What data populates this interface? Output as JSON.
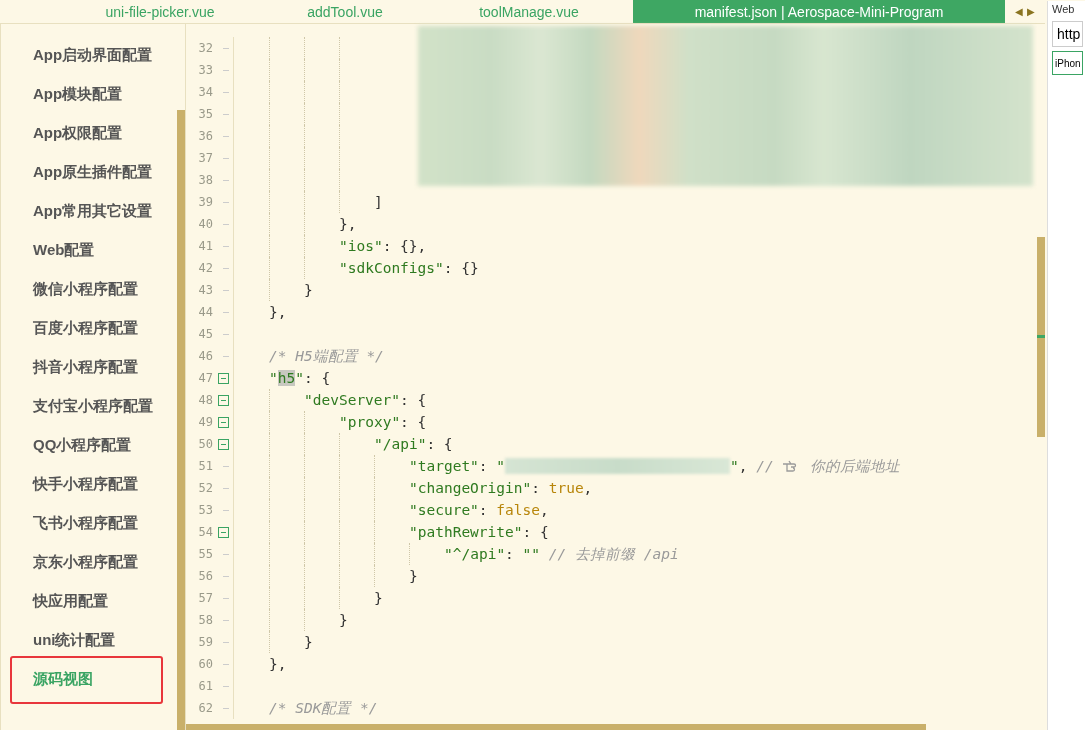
{
  "tabs": [
    {
      "label": "uni-file-picker.vue",
      "selected": false
    },
    {
      "label": "addTool.vue",
      "selected": false
    },
    {
      "label": "toolManage.vue",
      "selected": false
    },
    {
      "label": "manifest.json | Aerospace-Mini-Program",
      "selected": true
    }
  ],
  "tab_arrows": [
    "◀",
    "▶"
  ],
  "sidebar": {
    "items": [
      {
        "label": "App启动界面配置",
        "selected": false,
        "outlined": false
      },
      {
        "label": "App模块配置",
        "selected": false,
        "outlined": false
      },
      {
        "label": "App权限配置",
        "selected": false,
        "outlined": false
      },
      {
        "label": "App原生插件配置",
        "selected": false,
        "outlined": false
      },
      {
        "label": "App常用其它设置",
        "selected": false,
        "outlined": false
      },
      {
        "label": "Web配置",
        "selected": false,
        "outlined": false
      },
      {
        "label": "微信小程序配置",
        "selected": false,
        "outlined": false
      },
      {
        "label": "百度小程序配置",
        "selected": false,
        "outlined": false
      },
      {
        "label": "抖音小程序配置",
        "selected": false,
        "outlined": false
      },
      {
        "label": "支付宝小程序配置",
        "selected": false,
        "outlined": false
      },
      {
        "label": "QQ小程序配置",
        "selected": false,
        "outlined": false
      },
      {
        "label": "快手小程序配置",
        "selected": false,
        "outlined": false
      },
      {
        "label": "飞书小程序配置",
        "selected": false,
        "outlined": false
      },
      {
        "label": "京东小程序配置",
        "selected": false,
        "outlined": false
      },
      {
        "label": "快应用配置",
        "selected": false,
        "outlined": false
      },
      {
        "label": "uni统计配置",
        "selected": false,
        "outlined": false
      },
      {
        "label": "源码视图",
        "selected": true,
        "outlined": true
      }
    ]
  },
  "editor": {
    "lines": [
      {
        "children": [
          {
            "children": [
              {
                "children": [
                  {
                    "number": "32",
                    "fold": false,
                    "tokens": [
                      {
                        "kind": "blurred_block"
                      }
                    ]
                  },
                  {
                    "number": "33",
                    "fold": false
                  },
                  {
                    "number": "34",
                    "fold": false
                  },
                  {
                    "number": "35",
                    "fold": false
                  },
                  {
                    "number": "36",
                    "fold": false
                  },
                  {
                    "number": "37",
                    "fold": false
                  },
                  {
                    "number": "38",
                    "fold": false
                  },
                  {
                    "number": "39",
                    "fold": false,
                    "tokens": [
                      {
                        "kind": "punct",
                        "text": "]"
                      }
                    ]
                  }
                ]
              },
              {
                "number": "40",
                "fold": false,
                "tokens": [
                  {
                    "kind": "punct",
                    "text": "},"
                  }
                ]
              },
              {
                "number": "41",
                "fold": false,
                "tokens": [
                  {
                    "kind": "key",
                    "text": "\"ios\""
                  },
                  {
                    "kind": "punct",
                    "text": ": {},"
                  }
                ]
              },
              {
                "number": "42",
                "fold": false,
                "tokens": [
                  {
                    "kind": "key",
                    "text": "\"sdkConfigs\""
                  },
                  {
                    "kind": "punct",
                    "text": ": {}"
                  }
                ]
              }
            ]
          },
          {
            "number": "43",
            "fold": false,
            "tokens": [
              {
                "kind": "punct",
                "text": "}"
              }
            ]
          }
        ]
      },
      {
        "number": "44",
        "fold": false,
        "tokens": [
          {
            "kind": "punct",
            "text": "},"
          }
        ]
      },
      {
        "number": "45",
        "fold": false
      },
      {
        "number": "46",
        "fold": false,
        "tokens": [
          {
            "kind": "comment",
            "text": "/* H5端配置 */"
          }
        ]
      },
      {
        "number": "47",
        "fold": true,
        "tokens": [
          {
            "kind": "key",
            "text": "\""
          },
          {
            "kind": "match",
            "text": "h5"
          },
          {
            "kind": "key",
            "text": "\""
          },
          {
            "kind": "punct",
            "text": ": {"
          }
        ],
        "children": [
          {
            "number": "48",
            "fold": true,
            "tokens": [
              {
                "kind": "key",
                "text": "\"devServer\""
              },
              {
                "kind": "punct",
                "text": ": {"
              }
            ],
            "children": [
              {
                "number": "49",
                "fold": true,
                "tokens": [
                  {
                    "kind": "key",
                    "text": "\"proxy\""
                  },
                  {
                    "kind": "punct",
                    "text": ": {"
                  }
                ],
                "children": [
                  {
                    "number": "50",
                    "fold": true,
                    "tokens": [
                      {
                        "kind": "key",
                        "text": "\"/api\""
                      },
                      {
                        "kind": "punct",
                        "text": ": {"
                      }
                    ],
                    "children": [
                      {
                        "number": "51",
                        "fold": false,
                        "tokens": [
                          {
                            "kind": "key",
                            "text": "\"target\""
                          },
                          {
                            "kind": "punct",
                            "text": ": "
                          },
                          {
                            "kind": "string",
                            "text": "\""
                          },
                          {
                            "kind": "blurred_text"
                          },
                          {
                            "kind": "string",
                            "text": "\""
                          },
                          {
                            "kind": "punct",
                            "text": ", "
                          },
                          {
                            "kind": "comment",
                            "text": "//"
                          },
                          {
                            "kind": "hand"
                          },
                          {
                            "kind": "comment",
                            "text": "你的后端地址"
                          }
                        ]
                      },
                      {
                        "number": "52",
                        "fold": false,
                        "tokens": [
                          {
                            "kind": "key",
                            "text": "\"changeOrigin\""
                          },
                          {
                            "kind": "punct",
                            "text": ": "
                          },
                          {
                            "kind": "literal",
                            "text": "true"
                          },
                          {
                            "kind": "punct",
                            "text": ","
                          }
                        ]
                      },
                      {
                        "number": "53",
                        "fold": false,
                        "tokens": [
                          {
                            "kind": "key",
                            "text": "\"secure\""
                          },
                          {
                            "kind": "punct",
                            "text": ": "
                          },
                          {
                            "kind": "literal",
                            "text": "false"
                          },
                          {
                            "kind": "punct",
                            "text": ","
                          }
                        ]
                      },
                      {
                        "number": "54",
                        "fold": true,
                        "tokens": [
                          {
                            "kind": "key",
                            "text": "\"pathRewrite\""
                          },
                          {
                            "kind": "punct",
                            "text": ": {"
                          }
                        ],
                        "children": [
                          {
                            "number": "55",
                            "fold": false,
                            "tokens": [
                              {
                                "kind": "key",
                                "text": "\"^/api\""
                              },
                              {
                                "kind": "punct",
                                "text": ": "
                              },
                              {
                                "kind": "string",
                                "text": "\"\""
                              },
                              {
                                "kind": "comment",
                                "text": " // 去掉前缀 /api"
                              }
                            ]
                          }
                        ]
                      },
                      {
                        "number": "56",
                        "fold": false,
                        "tokens": [
                          {
                            "kind": "punct",
                            "text": "}"
                          }
                        ]
                      }
                    ]
                  },
                  {
                    "number": "57",
                    "fold": false,
                    "tokens": [
                      {
                        "kind": "punct",
                        "text": "}"
                      }
                    ]
                  }
                ]
              },
              {
                "number": "58",
                "fold": false,
                "tokens": [
                  {
                    "kind": "punct",
                    "text": "}"
                  }
                ]
              }
            ]
          },
          {
            "number": "59",
            "fold": false,
            "tokens": [
              {
                "kind": "punct",
                "text": "}"
              }
            ]
          }
        ]
      },
      {
        "number": "60",
        "fold": false,
        "tokens": [
          {
            "kind": "punct",
            "text": "},"
          }
        ]
      },
      {
        "number": "61",
        "fold": false
      },
      {
        "number": "62",
        "fold": false,
        "tokens": [
          {
            "kind": "comment",
            "text": "/* SDK配置 */"
          }
        ]
      }
    ]
  },
  "right_panel": {
    "heading": "Web",
    "url_value": "http",
    "device_value": "iPhon"
  }
}
